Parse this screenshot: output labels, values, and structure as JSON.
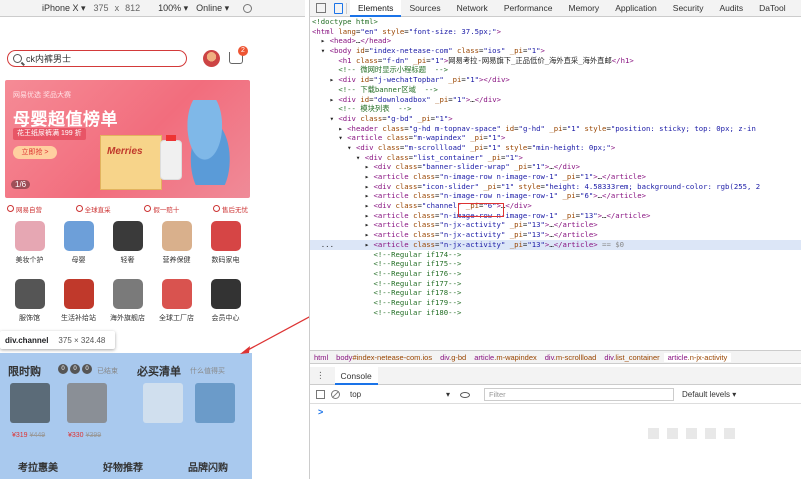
{
  "device_toolbar": {
    "device": "iPhone X ▾",
    "width": "375",
    "times": "x",
    "height": "812",
    "zoom": "100% ▾",
    "network": "Online ▾"
  },
  "mobile": {
    "search_text": "ck内裤男士",
    "cart_count": "2",
    "banner": {
      "tag_line": "网易优选 奖品大赛",
      "headline": "母婴超值榜单",
      "sub": "花王纸尿裤满 199 折",
      "cta": "立即抢 >",
      "page": "1/6",
      "box_logo": "Merries"
    },
    "features": [
      "网易自营",
      "全球直采",
      "假一赔十",
      "售后无忧"
    ],
    "icons": [
      {
        "label": "美妆个护",
        "color": "#e6a7b3"
      },
      {
        "label": "母婴",
        "color": "#6d9fd9"
      },
      {
        "label": "轻奢",
        "color": "#3a3a3a"
      },
      {
        "label": "营养保健",
        "color": "#d9b08c"
      },
      {
        "label": "数码家电",
        "color": "#d64545"
      },
      {
        "label": "服饰馆",
        "color": "#555555"
      },
      {
        "label": "生活补给站",
        "color": "#c0392b"
      },
      {
        "label": "海外旗舰店",
        "color": "#7a7a7a"
      },
      {
        "label": "全球工厂店",
        "color": "#d9534f"
      },
      {
        "label": "会员中心",
        "color": "#333333"
      }
    ],
    "tooltip": {
      "name": "div.channel",
      "dims": "375 × 324.48"
    },
    "channel": {
      "title": "限时购",
      "dots": [
        "0",
        "0",
        "0"
      ],
      "note": "已结束",
      "title2": "必买清单",
      "note2": "什么值得买",
      "products": [
        {
          "color": "#5b6b78",
          "price": "¥319",
          "old": "¥449"
        },
        {
          "color": "#8a8f96",
          "price": "¥330",
          "old": "¥399"
        },
        {
          "color": "#d0dfee",
          "price": "",
          "old": ""
        },
        {
          "color": "#6b9bc9",
          "price": "",
          "old": ""
        }
      ],
      "bottom": [
        "考拉惠美",
        "好物推荐",
        "品牌闪购"
      ]
    }
  },
  "devtools": {
    "tabs": [
      "Elements",
      "Sources",
      "Network",
      "Performance",
      "Memory",
      "Application",
      "Security",
      "Audits",
      "DaTool"
    ],
    "active_tab": "Elements",
    "dom_lines": [
      [
        [
          "t-com",
          "<!doctype html>"
        ]
      ],
      [
        [
          "t-tag",
          "<html "
        ],
        [
          "t-attr",
          "lang"
        ],
        [
          "t-plain",
          "="
        ],
        [
          "t-val",
          "\"en\" "
        ],
        [
          "t-attr",
          "style"
        ],
        [
          "t-plain",
          "="
        ],
        [
          "t-val",
          "\"font-size: 37.5px;\""
        ],
        [
          "t-tag",
          ">"
        ]
      ],
      [
        [
          "t-plain",
          "  ▸ "
        ],
        [
          "t-tag",
          "<head>"
        ],
        [
          "t-plain",
          "…"
        ],
        [
          "t-tag",
          "</head>"
        ]
      ],
      [
        [
          "t-plain",
          "  ▾ "
        ],
        [
          "t-tag",
          "<body "
        ],
        [
          "t-attr",
          "id"
        ],
        [
          "t-plain",
          "="
        ],
        [
          "t-val",
          "\"index-netease-com\" "
        ],
        [
          "t-attr",
          "class"
        ],
        [
          "t-plain",
          "="
        ],
        [
          "t-val",
          "\"ios\" "
        ],
        [
          "t-attr",
          "_pi"
        ],
        [
          "t-plain",
          "="
        ],
        [
          "t-val",
          "\"1\""
        ],
        [
          "t-tag",
          ">"
        ]
      ],
      [
        [
          "t-plain",
          "      "
        ],
        [
          "t-tag",
          "<h1 "
        ],
        [
          "t-attr",
          "class"
        ],
        [
          "t-plain",
          "="
        ],
        [
          "t-val",
          "\"f-dn\" "
        ],
        [
          "t-attr",
          "_pi"
        ],
        [
          "t-plain",
          "="
        ],
        [
          "t-val",
          "\"1\""
        ],
        [
          "t-tag",
          ">"
        ],
        [
          "t-plain",
          "网易考拉-网易旗下_正品低价_海外直采_海外直邮"
        ],
        [
          "t-tag",
          "</h1>"
        ]
      ],
      [
        [
          "t-com",
          "      <!-- 微网时显示小程标题  -->"
        ]
      ],
      [
        [
          "t-plain",
          "    ▸ "
        ],
        [
          "t-tag",
          "<div "
        ],
        [
          "t-attr",
          "id"
        ],
        [
          "t-plain",
          "="
        ],
        [
          "t-val",
          "\"j-wechatTopbar\" "
        ],
        [
          "t-attr",
          "_pi"
        ],
        [
          "t-plain",
          "="
        ],
        [
          "t-val",
          "\"1\""
        ],
        [
          "t-tag",
          "></div>"
        ]
      ],
      [
        [
          "t-com",
          "      <!-- 下载banner区域  -->"
        ]
      ],
      [
        [
          "t-plain",
          "    ▸ "
        ],
        [
          "t-tag",
          "<div "
        ],
        [
          "t-attr",
          "id"
        ],
        [
          "t-plain",
          "="
        ],
        [
          "t-val",
          "\"downloadbox\" "
        ],
        [
          "t-attr",
          "_pi"
        ],
        [
          "t-plain",
          "="
        ],
        [
          "t-val",
          "\"1\""
        ],
        [
          "t-tag",
          ">"
        ],
        [
          "t-plain",
          "…"
        ],
        [
          "t-tag",
          "</div>"
        ]
      ],
      [
        [
          "t-com",
          "      <!-- 模块列表  -->"
        ]
      ],
      [
        [
          "t-plain",
          "    ▾ "
        ],
        [
          "t-tag",
          "<div "
        ],
        [
          "t-attr",
          "class"
        ],
        [
          "t-plain",
          "="
        ],
        [
          "t-val",
          "\"g-bd\" "
        ],
        [
          "t-attr",
          "_pi"
        ],
        [
          "t-plain",
          "="
        ],
        [
          "t-val",
          "\"1\""
        ],
        [
          "t-tag",
          ">"
        ]
      ],
      [
        [
          "t-plain",
          "      ▸ "
        ],
        [
          "t-tag",
          "<header "
        ],
        [
          "t-attr",
          "class"
        ],
        [
          "t-plain",
          "="
        ],
        [
          "t-val",
          "\"g-hd m-topnav-space\" "
        ],
        [
          "t-attr",
          "id"
        ],
        [
          "t-plain",
          "="
        ],
        [
          "t-val",
          "\"g-hd\" "
        ],
        [
          "t-attr",
          "_pi"
        ],
        [
          "t-plain",
          "="
        ],
        [
          "t-val",
          "\"1\" "
        ],
        [
          "t-attr",
          "style"
        ],
        [
          "t-plain",
          "="
        ],
        [
          "t-val",
          "\"position: sticky; top: 0px; z-in"
        ]
      ],
      [
        [
          "t-plain",
          "      ▾ "
        ],
        [
          "t-tag",
          "<article "
        ],
        [
          "t-attr",
          "class"
        ],
        [
          "t-plain",
          "="
        ],
        [
          "t-val",
          "\"m-wapindex\" "
        ],
        [
          "t-attr",
          "_pi"
        ],
        [
          "t-plain",
          "="
        ],
        [
          "t-val",
          "\"1\""
        ],
        [
          "t-tag",
          ">"
        ]
      ],
      [
        [
          "t-plain",
          "        ▾ "
        ],
        [
          "t-tag",
          "<div "
        ],
        [
          "t-attr",
          "class"
        ],
        [
          "t-plain",
          "="
        ],
        [
          "t-val",
          "\"m-scrollload\" "
        ],
        [
          "t-attr",
          "_pi"
        ],
        [
          "t-plain",
          "="
        ],
        [
          "t-val",
          "\"1\" "
        ],
        [
          "t-attr",
          "style"
        ],
        [
          "t-plain",
          "="
        ],
        [
          "t-val",
          "\"min-height: 0px;\""
        ],
        [
          "t-tag",
          ">"
        ]
      ],
      [
        [
          "t-plain",
          "          ▾ "
        ],
        [
          "t-tag",
          "<div "
        ],
        [
          "t-attr",
          "class"
        ],
        [
          "t-plain",
          "="
        ],
        [
          "t-val",
          "\"list_container\" "
        ],
        [
          "t-attr",
          "_pi"
        ],
        [
          "t-plain",
          "="
        ],
        [
          "t-val",
          "\"1\""
        ],
        [
          "t-tag",
          ">"
        ]
      ],
      [
        [
          "t-plain",
          "            ▸ "
        ],
        [
          "t-tag",
          "<div "
        ],
        [
          "t-attr",
          "class"
        ],
        [
          "t-plain",
          "="
        ],
        [
          "t-val",
          "\"banner-slider-wrap\" "
        ],
        [
          "t-attr",
          "_pi"
        ],
        [
          "t-plain",
          "="
        ],
        [
          "t-val",
          "\"1\""
        ],
        [
          "t-tag",
          ">"
        ],
        [
          "t-plain",
          "…"
        ],
        [
          "t-tag",
          "</div>"
        ]
      ],
      [
        [
          "t-plain",
          "            ▸ "
        ],
        [
          "t-tag",
          "<article "
        ],
        [
          "t-attr",
          "class"
        ],
        [
          "t-plain",
          "="
        ],
        [
          "t-val",
          "\"n-image-row n-image-row-1\" "
        ],
        [
          "t-attr",
          "_pi"
        ],
        [
          "t-plain",
          "="
        ],
        [
          "t-val",
          "\"1\""
        ],
        [
          "t-tag",
          ">"
        ],
        [
          "t-plain",
          "…"
        ],
        [
          "t-tag",
          "</article>"
        ]
      ],
      [
        [
          "t-plain",
          "            ▸ "
        ],
        [
          "t-tag",
          "<div "
        ],
        [
          "t-attr",
          "class"
        ],
        [
          "t-plain",
          "="
        ],
        [
          "t-val",
          "\"icon-slider\" "
        ],
        [
          "t-attr",
          "_pi"
        ],
        [
          "t-plain",
          "="
        ],
        [
          "t-val",
          "\"1\" "
        ],
        [
          "t-attr",
          "style"
        ],
        [
          "t-plain",
          "="
        ],
        [
          "t-val",
          "\"height: 4.58333rem; background-color: rgb(255, 2"
        ]
      ],
      [
        [
          "t-plain",
          "            ▸ "
        ],
        [
          "t-tag",
          "<article "
        ],
        [
          "t-attr",
          "class"
        ],
        [
          "t-plain",
          "="
        ],
        [
          "t-val",
          "\"n-image-row n-image-row-1\" "
        ],
        [
          "t-attr",
          "_pi"
        ],
        [
          "t-plain",
          "="
        ],
        [
          "t-val",
          "\"6\""
        ],
        [
          "t-tag",
          ">"
        ],
        [
          "t-plain",
          "…"
        ],
        [
          "t-tag",
          "</article>"
        ]
      ],
      [
        [
          "t-plain",
          "            ▸ "
        ],
        [
          "t-tag",
          "<div "
        ],
        [
          "t-attr",
          "class"
        ],
        [
          "t-plain",
          "="
        ],
        [
          "t-val",
          "\"channel\" "
        ],
        [
          "t-attr",
          "_pi"
        ],
        [
          "t-plain",
          "="
        ],
        [
          "t-val",
          "\"6\""
        ],
        [
          "t-tag",
          ">"
        ],
        [
          "t-plain",
          "…"
        ],
        [
          "t-tag",
          "</div>"
        ]
      ],
      [
        [
          "t-plain",
          "            ▸ "
        ],
        [
          "t-tag",
          "<article "
        ],
        [
          "t-attr",
          "class"
        ],
        [
          "t-plain",
          "="
        ],
        [
          "t-val",
          "\"n-image-row n-image-row-1\" "
        ],
        [
          "t-attr",
          "_pi"
        ],
        [
          "t-plain",
          "="
        ],
        [
          "t-val",
          "\"13\""
        ],
        [
          "t-tag",
          ">"
        ],
        [
          "t-plain",
          "…"
        ],
        [
          "t-tag",
          "</article>"
        ]
      ],
      [
        [
          "t-plain",
          "            ▸ "
        ],
        [
          "t-tag",
          "<article "
        ],
        [
          "t-attr",
          "class"
        ],
        [
          "t-plain",
          "="
        ],
        [
          "t-val",
          "\"n-jx-activity\" "
        ],
        [
          "t-attr",
          "_pi"
        ],
        [
          "t-plain",
          "="
        ],
        [
          "t-val",
          "\"13\""
        ],
        [
          "t-tag",
          ">"
        ],
        [
          "t-plain",
          "…"
        ],
        [
          "t-tag",
          "</article>"
        ]
      ],
      [
        [
          "t-plain",
          "            ▸ "
        ],
        [
          "t-tag",
          "<article "
        ],
        [
          "t-attr",
          "class"
        ],
        [
          "t-plain",
          "="
        ],
        [
          "t-val",
          "\"n-jx-activity\" "
        ],
        [
          "t-attr",
          "_pi"
        ],
        [
          "t-plain",
          "="
        ],
        [
          "t-val",
          "\"13\""
        ],
        [
          "t-tag",
          ">"
        ],
        [
          "t-plain",
          "…"
        ],
        [
          "t-tag",
          "</article>"
        ]
      ],
      [
        [
          "t-plain",
          "  ...       ▸ "
        ],
        [
          "t-tag",
          "<article "
        ],
        [
          "t-attr",
          "class"
        ],
        [
          "t-plain",
          "="
        ],
        [
          "t-val",
          "\"n-jx-activity\" "
        ],
        [
          "t-attr",
          "_pi"
        ],
        [
          "t-plain",
          "="
        ],
        [
          "t-val",
          "\"13\""
        ],
        [
          "t-tag",
          ">"
        ],
        [
          "t-plain",
          "…"
        ],
        [
          "t-tag",
          "</article>"
        ],
        [
          "t-hint",
          " == $0"
        ]
      ],
      [
        [
          "t-com",
          "              <!--Regular if174-->"
        ]
      ],
      [
        [
          "t-com",
          "              <!--Regular if175-->"
        ]
      ],
      [
        [
          "t-com",
          "              <!--Regular if176-->"
        ]
      ],
      [
        [
          "t-com",
          "              <!--Regular if177-->"
        ]
      ],
      [
        [
          "t-com",
          "              <!--Regular if178-->"
        ]
      ],
      [
        [
          "t-com",
          "              <!--Regular if179-->"
        ]
      ],
      [
        [
          "t-com",
          "              <!--Regular if180-->"
        ]
      ]
    ],
    "selected_line": 23,
    "breadcrumbs": [
      {
        "tag": "html",
        "rest": ""
      },
      {
        "tag": "body",
        "rest": "#index-netease-com.ios"
      },
      {
        "tag": "div",
        "rest": ".g-bd"
      },
      {
        "tag": "article",
        "rest": ".m-wapindex"
      },
      {
        "tag": "div",
        "rest": ".m-scrollload"
      },
      {
        "tag": "div",
        "rest": ".list_container"
      },
      {
        "tag": "article",
        "rest": ".n-jx-activity"
      }
    ],
    "console": {
      "tab": "Console",
      "context": "top",
      "filter_placeholder": "Filter",
      "levels": "Default levels ▾",
      "prompt": ">"
    }
  }
}
